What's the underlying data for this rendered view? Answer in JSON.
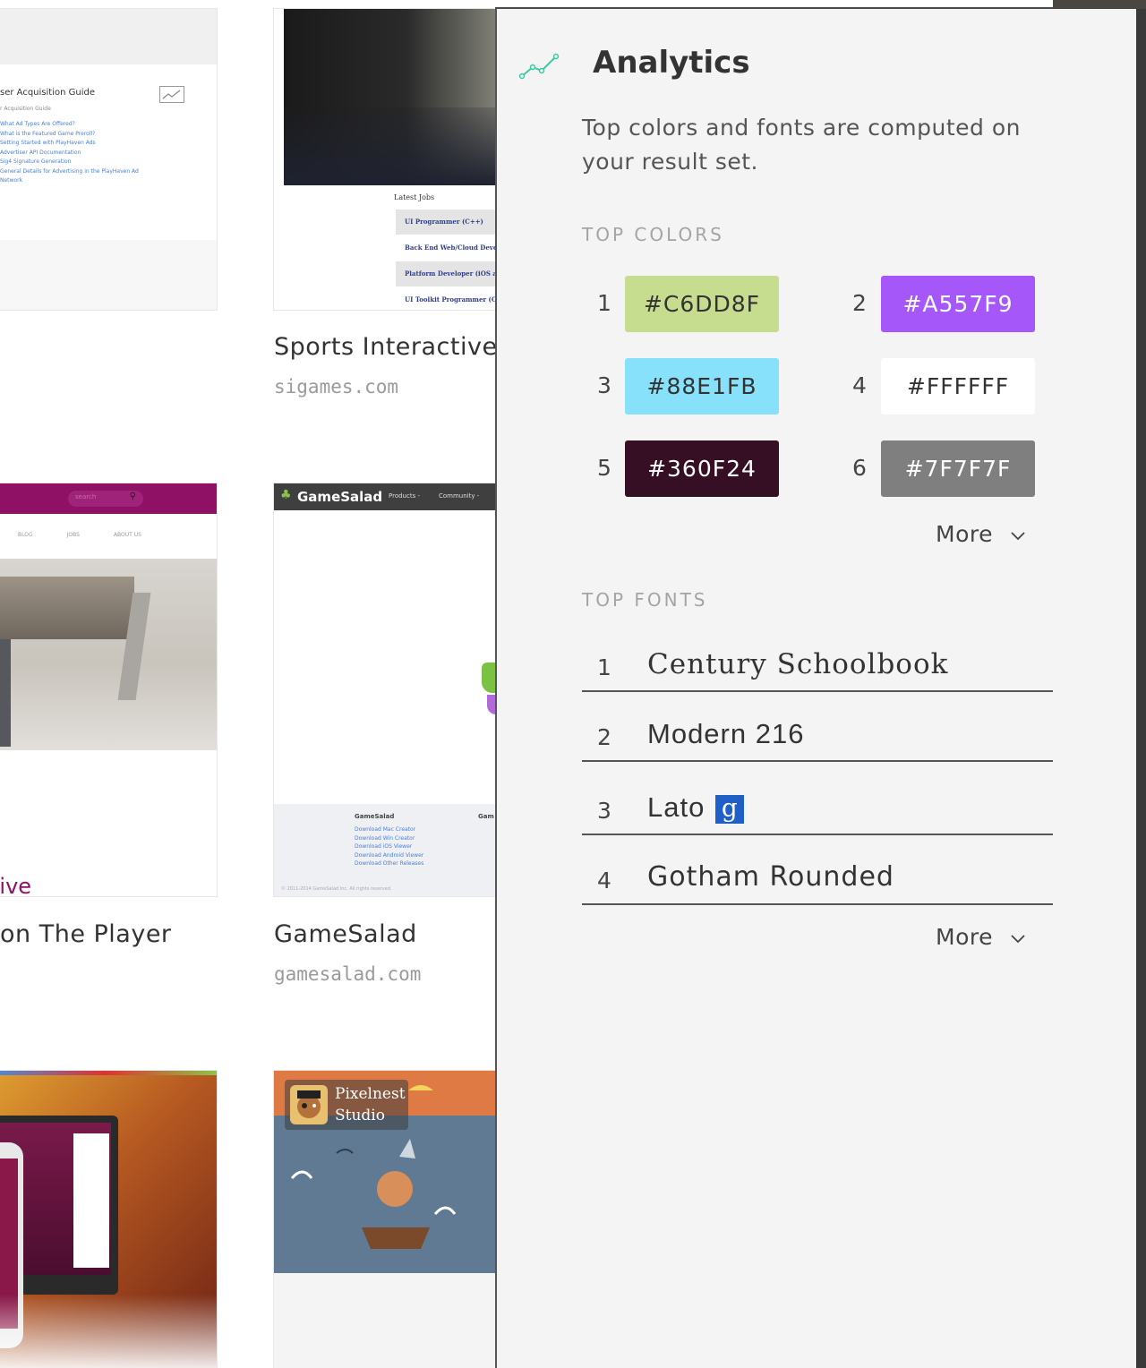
{
  "cards": [
    {
      "title": "Sports Interactive",
      "domain": "sigames.com"
    },
    {
      "title": "on The Player",
      "domain": ""
    },
    {
      "title": "GameSalad",
      "domain": "gamesalad.com"
    }
  ],
  "thumb_text": {
    "guide_title": "ser Acquisition Guide",
    "guide_sub": "r Acquisition Guide",
    "guide_links": [
      "What Ad Types Are Offered?",
      "What is the Featured Game Preroll?",
      "Setting Started with PlayHaven Ads",
      "Advertiser API Documentation",
      "Sig4 Signature Generation",
      "General Details for Advertising in the PlayHaven Ad",
      "Network"
    ],
    "jobs_title": "Latest Jobs",
    "jobs": [
      "UI Programmer (C++)",
      "Back End Web/Cloud Develop",
      "Platform Developer (iOS and",
      "UI Toolkit Programmer (C++"
    ],
    "nav": [
      "BLOG",
      "JOBS",
      "ABOUT US"
    ],
    "search": "search",
    "partial_word": "tive",
    "gs_logo": "GameSalad",
    "gs_nav": [
      "Products -",
      "Community -"
    ],
    "gs_footer_title": "GameSalad",
    "gs_footer_col2": "Gam",
    "gs_links": [
      "Download Mac Creator",
      "Download Win Creator",
      "Download iOS Viewer",
      "Download Android Viewer",
      "Download Other Releases"
    ],
    "gs_copyright": "© 2011-2014 GameSalad Inc. All rights reserved.",
    "pixelnest": [
      "Pixelnest",
      "Studio"
    ]
  },
  "analytics": {
    "title": "Analytics",
    "icon": "trend-line-icon",
    "description": "Top colors and fonts are computed on your result set.",
    "top_colors_label": "TOP COLORS",
    "colors": [
      {
        "rank": "1",
        "hex": "#C6DD8F",
        "text_color": "#333333"
      },
      {
        "rank": "2",
        "hex": "#A557F9",
        "text_color": "#ffffff"
      },
      {
        "rank": "3",
        "hex": "#88E1FB",
        "text_color": "#333333"
      },
      {
        "rank": "4",
        "hex": "#FFFFFF",
        "text_color": "#333333"
      },
      {
        "rank": "5",
        "hex": "#360F24",
        "text_color": "#ffffff"
      },
      {
        "rank": "6",
        "hex": "#7F7F7F",
        "text_color": "#ffffff"
      }
    ],
    "colors_more": "More",
    "top_fonts_label": "TOP FONTS",
    "fonts": [
      {
        "rank": "1",
        "name": "Century Schoolbook"
      },
      {
        "rank": "2",
        "name": "Modern 216"
      },
      {
        "rank": "3",
        "name": "Lato",
        "badge": "g"
      },
      {
        "rank": "4",
        "name": "Gotham Rounded"
      }
    ],
    "fonts_more": "More",
    "accent": "#3cc9a6"
  }
}
